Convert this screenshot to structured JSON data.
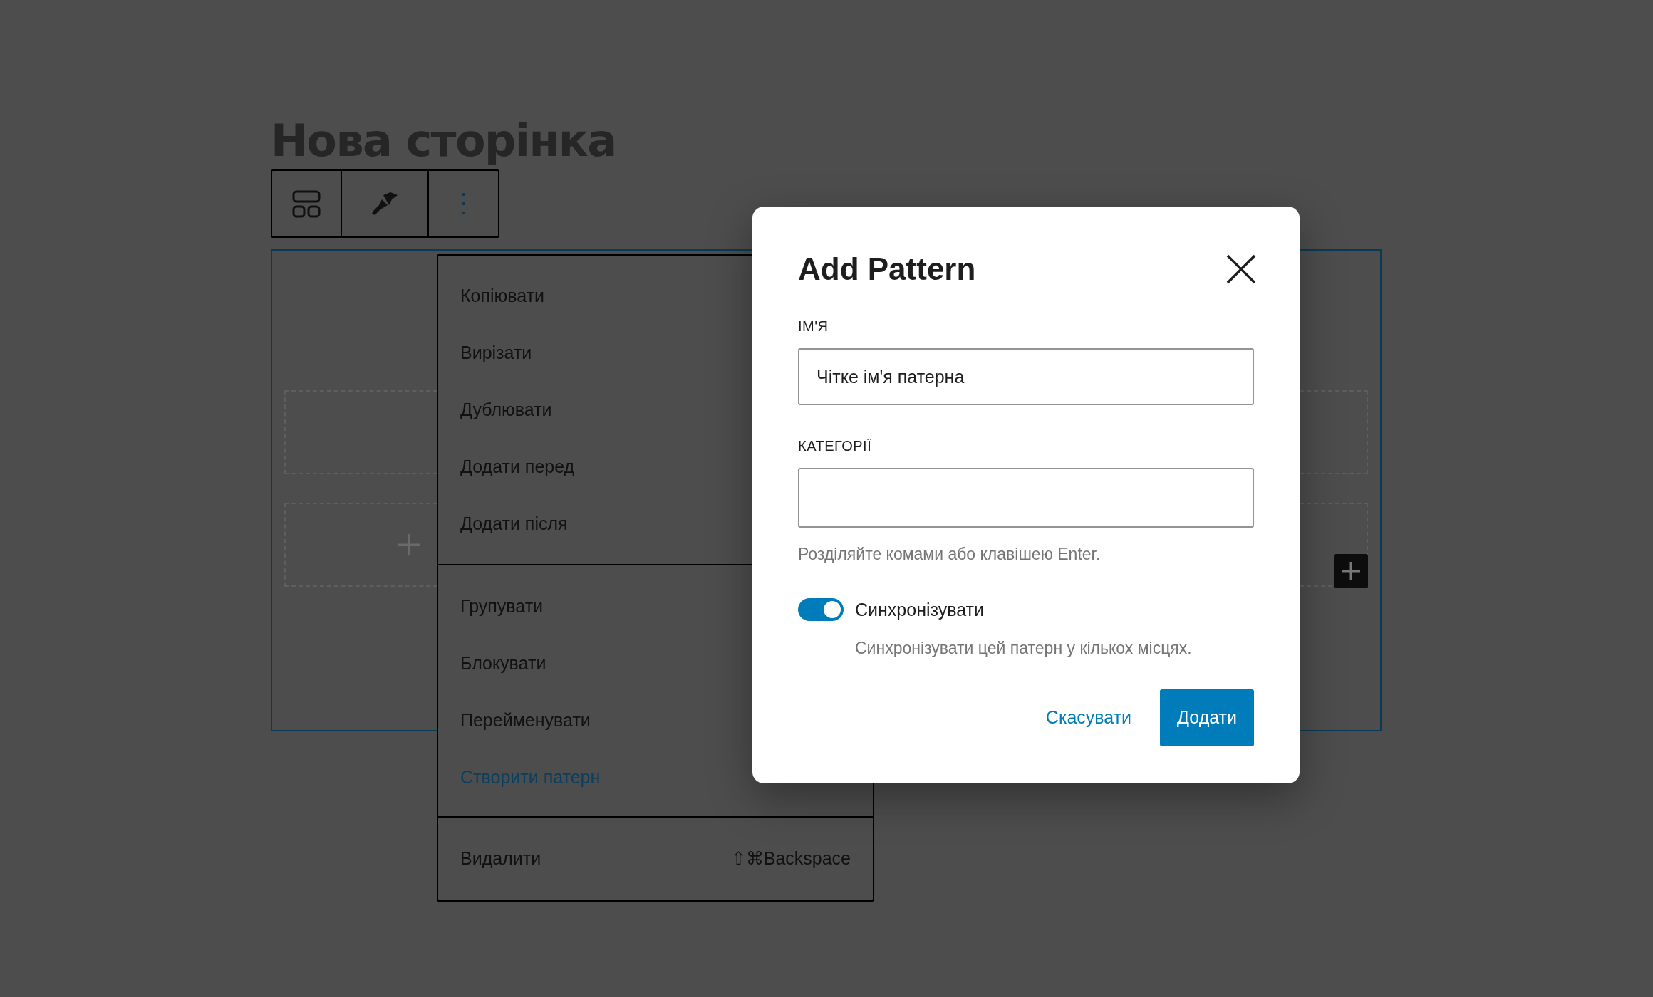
{
  "page": {
    "title": "Нова сторінка"
  },
  "context_menu": {
    "groups": [
      {
        "items": [
          {
            "label": "Копіювати",
            "selected": false
          },
          {
            "label": "Вирізати",
            "selected": false
          },
          {
            "label": "Дублювати",
            "selected": false
          },
          {
            "label": "Додати перед",
            "selected": false
          },
          {
            "label": "Додати після",
            "selected": false
          }
        ]
      },
      {
        "items": [
          {
            "label": "Групувати",
            "selected": false
          },
          {
            "label": "Блокувати",
            "selected": false
          },
          {
            "label": "Перейменувати",
            "selected": false
          },
          {
            "label": "Створити патерн",
            "selected": true
          }
        ]
      },
      {
        "items": [
          {
            "label": "Видалити",
            "selected": false,
            "shortcut": "⇧⌘Backspace"
          }
        ]
      }
    ]
  },
  "modal": {
    "title": "Add Pattern",
    "fields": [
      {
        "label": "ІМ'Я",
        "value": "Чітке ім'я патерна"
      },
      {
        "label": "КАТЕГОРІЇ",
        "help": "Розділяйте комами або клавішею Enter."
      }
    ],
    "sync": {
      "label": "Синхронізувати",
      "description": "Синхронізувати цей патерн у кількох місцях.",
      "on": true
    },
    "buttons": [
      {
        "label": "Скасувати",
        "kind": "link"
      },
      {
        "label": "Додати",
        "kind": "primary"
      }
    ]
  }
}
